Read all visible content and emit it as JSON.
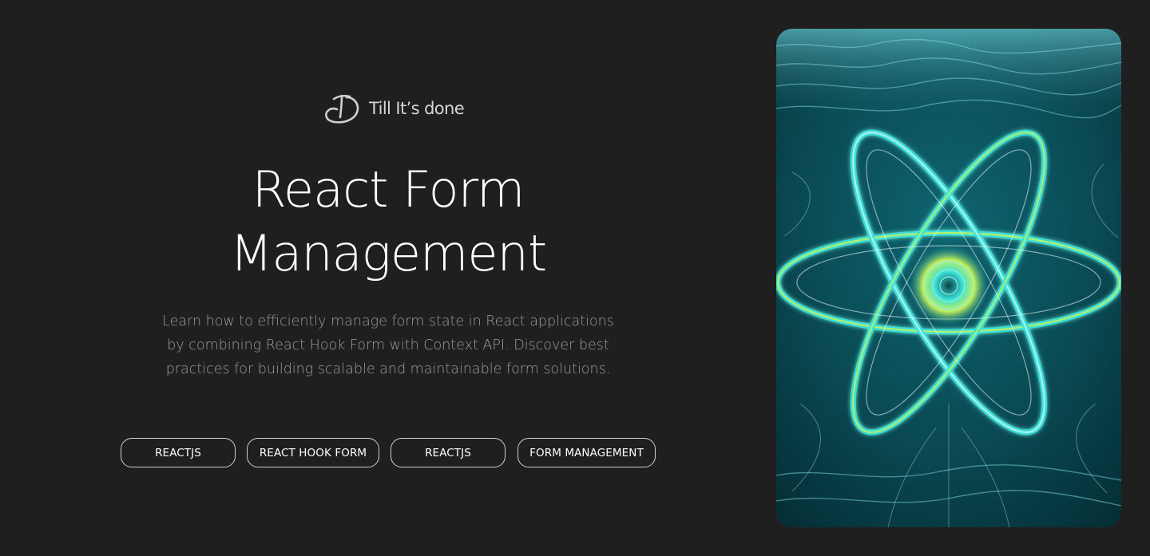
{
  "brand": {
    "logo_icon": "td-script-logo-icon",
    "name": "Till It’s done"
  },
  "hero": {
    "title_line_1": "React Form",
    "title_line_2": "Management",
    "description_lines": [
      "Learn how to efficiently manage form state in React applications",
      "by combining React Hook Form with Context API. Discover best",
      "practices for building scalable and maintainable form solutions."
    ]
  },
  "tags": [
    {
      "label": "REACTJS"
    },
    {
      "label": "REACT HOOK FORM"
    },
    {
      "label": "REACTJS"
    },
    {
      "label": "FORM MANAGEMENT"
    }
  ],
  "artwork": {
    "subject": "React atom logo formed by cyan ocean waves",
    "colors": {
      "deep_water": "#06313a",
      "water": "#0b5560",
      "glow": "#38e3dc",
      "highlight": "#d9f54a",
      "foam": "#e6fbff"
    }
  },
  "colors": {
    "background": "#1f1f1f",
    "title": "#ffffff",
    "description": "#9c9c9c",
    "tag_border": "#cfcfcf"
  }
}
